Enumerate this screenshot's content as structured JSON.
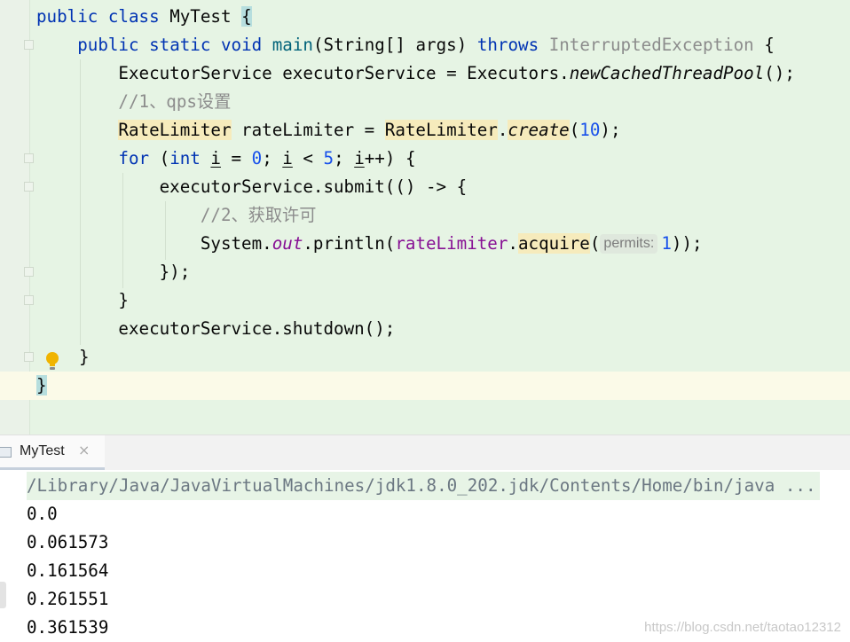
{
  "editor": {
    "line1": {
      "kw_public": "public",
      "kw_class": "class",
      "class_name": "MyTest",
      "brace": "{"
    },
    "line2": {
      "kw_public": "public",
      "kw_static": "static",
      "kw_void": "void",
      "method": "main",
      "params": "(String[] args) ",
      "kw_throws": "throws",
      "exception": "InterruptedException",
      "brace": " {"
    },
    "line3": {
      "text": "ExecutorService executorService = Executors.",
      "call": "newCachedThreadPool",
      "end": "();"
    },
    "line4": {
      "comment": "//1、qps设置"
    },
    "line5": {
      "type": "RateLimiter",
      "mid": " rateLimiter = ",
      "type2": "RateLimiter",
      "dot": ".",
      "call": "create",
      "open": "(",
      "num": "10",
      "end": ");"
    },
    "line6": {
      "kw_for": "for",
      "p1": " (",
      "kw_int": "int",
      "sp": " ",
      "var1": "i",
      "eq": " = ",
      "num0": "0",
      "semi": "; ",
      "var2": "i",
      "lt": " < ",
      "num5": "5",
      "semi2": "; ",
      "var3": "i",
      "end": "++) {"
    },
    "line7": {
      "text": "executorService.submit(() -> {"
    },
    "line8": {
      "comment": "//2、获取许可"
    },
    "line9": {
      "pre": "System.",
      "field": "out",
      "mid": ".println(",
      "ref": "rateLimiter",
      "dot": ".",
      "call": "acquire",
      "open": "(",
      "hint": "permits:",
      "num": "1",
      "end": "));"
    },
    "line10": {
      "text": "});"
    },
    "line11": {
      "text": "}"
    },
    "line12": {
      "text": "executorService.shutdown();"
    },
    "line13": {
      "text": "}"
    },
    "line14": {
      "text": "}"
    }
  },
  "run_tab": {
    "label": "MyTest",
    "close": "×"
  },
  "console": {
    "command": "/Library/Java/JavaVirtualMachines/jdk1.8.0_202.jdk/Contents/Home/bin/java ...",
    "output": [
      "0.0",
      "0.061573",
      "0.161564",
      "0.261551",
      "0.361539"
    ]
  },
  "watermark": "https://blog.csdn.net/taotao12312",
  "colors": {
    "keyword": "#0033b3",
    "number": "#1750eb",
    "comment": "#8c8c8c",
    "editor_bg": "#e6f4e4"
  }
}
